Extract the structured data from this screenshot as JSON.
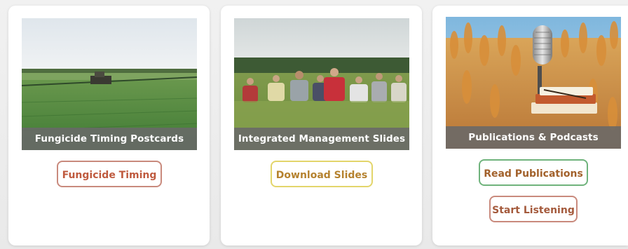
{
  "cards": [
    {
      "caption": "Fungicide Timing Postcards",
      "button": "Fungicide Timing",
      "image": "field-sprayer-photo"
    },
    {
      "caption": "Integrated Management Slides",
      "button": "Download Slides",
      "image": "field-group-photo"
    },
    {
      "caption": "Publications & Podcasts",
      "buttons": [
        "Read Publications",
        "Start Listening"
      ],
      "image": "wheat-microphone-photo"
    }
  ]
}
